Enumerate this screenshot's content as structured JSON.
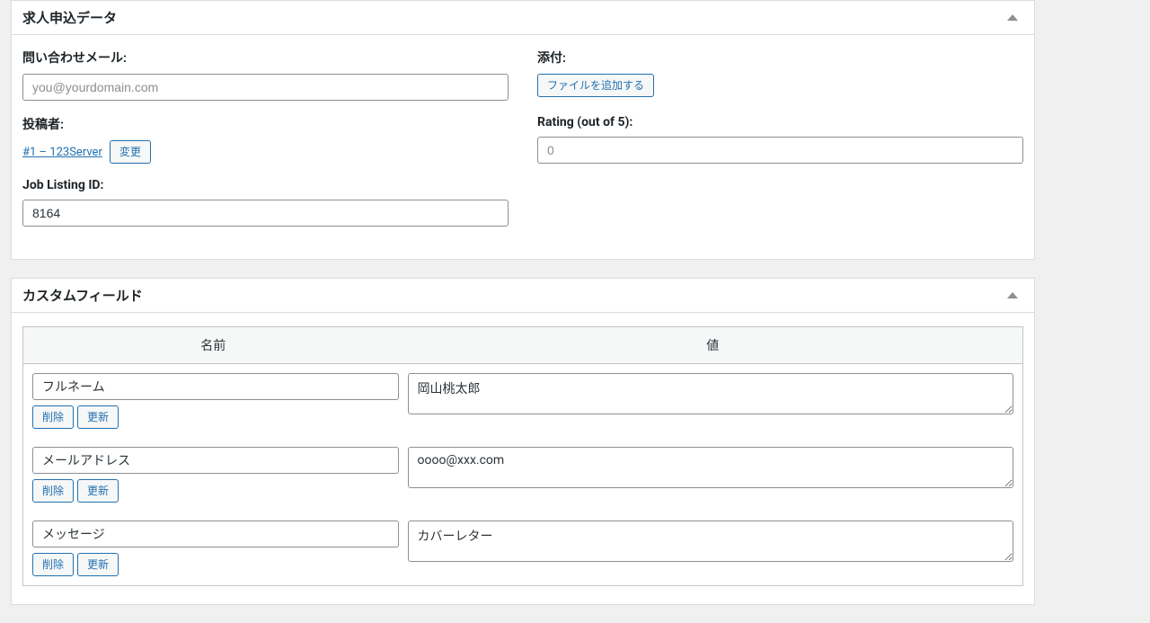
{
  "panel1": {
    "title": "求人申込データ",
    "contactEmail": {
      "label": "問い合わせメール:",
      "placeholder": "you@yourdomain.com",
      "value": ""
    },
    "attachment": {
      "label": "添付:",
      "button": "ファイルを追加する"
    },
    "postedBy": {
      "label": "投稿者:",
      "link": "#1 – 123Server",
      "button": "変更"
    },
    "rating": {
      "label": "Rating (out of 5):",
      "placeholder": "0",
      "value": ""
    },
    "jobListingId": {
      "label": "Job Listing ID:",
      "value": "8164"
    }
  },
  "panel2": {
    "title": "カスタムフィールド",
    "headers": {
      "name": "名前",
      "value": "値"
    },
    "deleteBtn": "削除",
    "updateBtn": "更新",
    "rows": [
      {
        "name": "フルネーム",
        "value": "岡山桃太郎"
      },
      {
        "name": "メールアドレス",
        "value": "oooo@xxx.com"
      },
      {
        "name": "メッセージ",
        "value": "カバーレター"
      }
    ]
  }
}
